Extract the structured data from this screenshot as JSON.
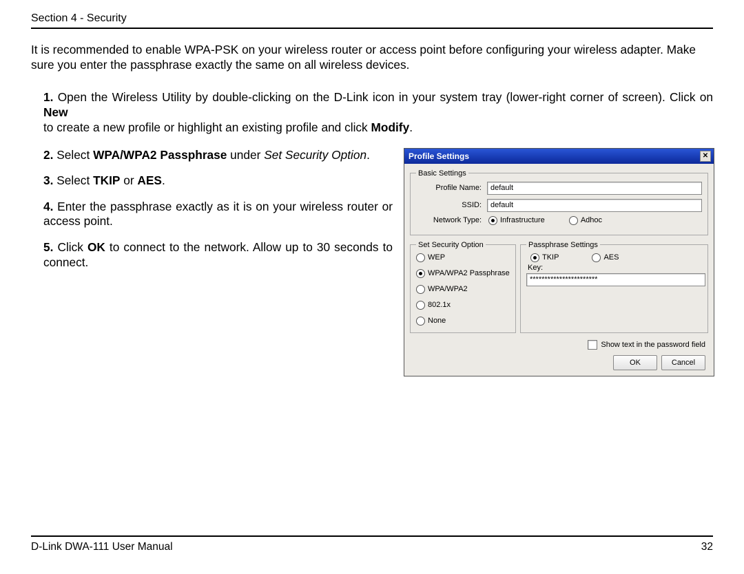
{
  "header": {
    "section_label": "Section 4 - Security"
  },
  "intro": "It is recommended to enable WPA-PSK on your wireless router or access point before configuring your wireless adapter. Make sure you enter the passphrase exactly the same on all wireless devices.",
  "steps": {
    "s1": {
      "num": "1.",
      "text_a": " Open the Wireless Utility by double-clicking on the D-Link icon in your system tray (lower-right corner of screen). Click on ",
      "bold_a": "New",
      "text_b": "to create a new profile or highlight an existing profile and click ",
      "bold_b": "Modify",
      "text_c": "."
    },
    "s2": {
      "num": "2.",
      "text_a": " Select ",
      "bold_a": "WPA/WPA2 Passphrase",
      "text_b": " under ",
      "italic_a": "Set Security Option",
      "text_c": "."
    },
    "s3": {
      "num": "3.",
      "text_a": " Select ",
      "bold_a": "TKIP",
      "text_b": " or ",
      "bold_b": "AES",
      "text_c": "."
    },
    "s4": {
      "num": "4.",
      "text_a": " Enter the passphrase exactly as it is on your wireless router or access point."
    },
    "s5": {
      "num": "5.",
      "text_a": " Click ",
      "bold_a": "OK",
      "text_b": " to connect to the network. Allow up to 30 seconds to connect."
    }
  },
  "dialog": {
    "title": "Profile Settings",
    "basic_legend": "Basic Settings",
    "profile_name_label": "Profile Name:",
    "profile_name_value": "default",
    "ssid_label": "SSID:",
    "ssid_value": "default",
    "network_type_label": "Network Type:",
    "network_type_infra": "Infrastructure",
    "network_type_adhoc": "Adhoc",
    "security_legend": "Set Security Option",
    "security_options": {
      "wep": "WEP",
      "wpa_pass": "WPA/WPA2 Passphrase",
      "wpa": "WPA/WPA2",
      "dot1x": "802.1x",
      "none": "None"
    },
    "passphrase_legend": "Passphrase Settings",
    "tkip": "TKIP",
    "aes": "AES",
    "key_label": "Key:",
    "key_value": "***********************",
    "show_text_label": "Show text in the password field",
    "ok": "OK",
    "cancel": "Cancel"
  },
  "footer": {
    "manual": "D-Link DWA-111 User Manual",
    "page": "32"
  }
}
